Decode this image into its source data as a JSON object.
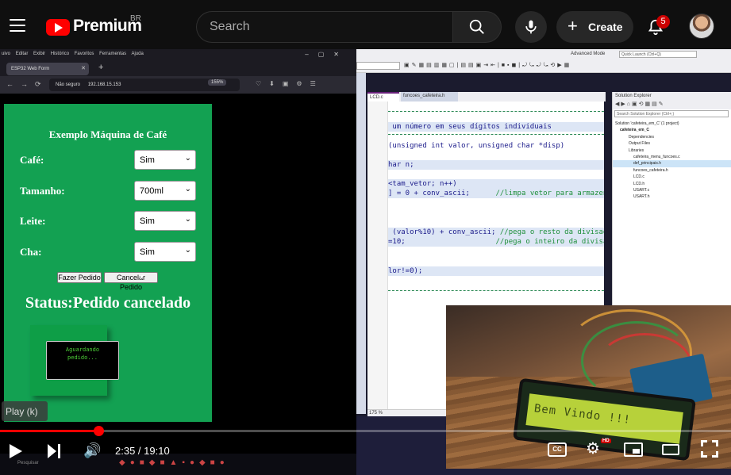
{
  "header": {
    "brand": "Premium",
    "region": "BR",
    "search_placeholder": "Search",
    "create_label": "Create",
    "notification_count": "5",
    "icons": {
      "menu": "hamburger-menu-icon",
      "logo": "youtube-logo-icon",
      "search": "search-icon",
      "mic": "microphone-icon",
      "create": "plus-icon",
      "bell": "bell-icon",
      "avatar": "user-avatar"
    }
  },
  "browser": {
    "menu": [
      "uivo",
      "Editar",
      "Exibir",
      "Histórico",
      "Favoritos",
      "Ferramentas",
      "Ajuda"
    ],
    "tab_title": "ESP32 Web Form",
    "url_insecure": "Não seguro",
    "url": "192.168.15.153",
    "zoom": "155%"
  },
  "webform": {
    "title": "Exemplo Máquina de Café",
    "fields": [
      {
        "label": "Café:",
        "value": "Sim"
      },
      {
        "label": "Tamanho:",
        "value": "700ml"
      },
      {
        "label": "Leite:",
        "value": "Sim"
      },
      {
        "label": "Cha:",
        "value": "Sim"
      }
    ],
    "order_button": "Fazer Pedido",
    "cancel_button": "Cancelar Pedido",
    "status": "Status:Pedido cancelado",
    "lcd_line1": "Aguardando",
    "lcd_line2": "pedido..."
  },
  "ide": {
    "mode": "Advanced Mode",
    "quick_launch": "Quick Launch (Ctrl+Q)",
    "doc_tabs": [
      "LCD.c",
      "funcoes_cafeteira.h"
    ],
    "code_lines": [
      {
        "text": " um número em seus dígitos individuais",
        "comment": false,
        "sel": true
      },
      {
        "text": "(unsigned int valor, unsigned char *disp)",
        "comment": false,
        "sel": true
      },
      {
        "text": "har n;",
        "comment": false,
        "sel": true
      },
      {
        "text": "<tam_vetor; n++)",
        "comment": false,
        "sel": true
      },
      {
        "text": "] = 0 + conv_ascii;      ",
        "comment": false,
        "sel": true,
        "trail": "//limpa vetor para armazena"
      },
      {
        "text": " (valor%10) + conv_ascii; ",
        "comment": false,
        "sel": true,
        "trail": "//pega o resto da divisao p"
      },
      {
        "text": "=10;                     ",
        "comment": false,
        "sel": true,
        "trail": "//pega o inteiro da divisão"
      },
      {
        "text": "lor!=0);",
        "comment": false,
        "sel": true
      }
    ],
    "zoom": "175 %",
    "solution_explorer": {
      "title": "Solution Explorer",
      "search": "Search Solution Explorer (Ctrl+;)",
      "items": [
        "Solution 'cafeteira_em_C' (1 project)",
        "cafeteira_em_C",
        "Dependencies",
        "Output Files",
        "Libraries",
        "cafeteira_menu_funcoes.c",
        "def_principais.h",
        "funcoes_cafeteira.h",
        "LCD.c",
        "LCD.h",
        "USART.c",
        "USART.h"
      ],
      "selected_index": 6
    }
  },
  "pip": {
    "lcd_text": "Bem Vindo !!!"
  },
  "player": {
    "time": "2:35 / 19:10",
    "progress": 0.1348,
    "play_tooltip": "Play (k)",
    "hd_badge": "HD",
    "cc_label": "CC",
    "icons": [
      "play-icon",
      "next-icon",
      "volume-icon",
      "captions-icon",
      "settings-icon",
      "miniplayer-icon",
      "theater-icon",
      "fullscreen-icon"
    ]
  },
  "taskbar": {
    "search": "Pesquisar"
  },
  "colors": {
    "youtube_red": "#ff0000",
    "form_green": "#13a152",
    "lcd_green": "#4cd137"
  }
}
